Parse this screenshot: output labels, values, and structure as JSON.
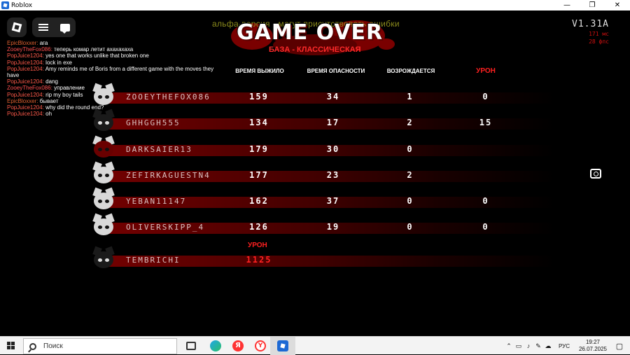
{
  "window": {
    "title": "Roblox",
    "minimize": "—",
    "restore": "❐",
    "close": "✕"
  },
  "chat": [
    {
      "name": "EpicBloxxer:",
      "name_color": "#e06030",
      "text": "ага"
    },
    {
      "name": "ZooeyTheFox086:",
      "name_color": "#ff5050",
      "text": "теперь комар летит ахахахаха"
    },
    {
      "name": "PopJuice1204:",
      "name_color": "#ff5a4a",
      "text": "yes one that works unlike that broken one"
    },
    {
      "name": "PopJuice1204:",
      "name_color": "#ff5a4a",
      "text": "lock in exe"
    },
    {
      "name": "PopJuice1204:",
      "name_color": "#ff5a4a",
      "text": "Amy reminds me of Boris from a different game with the moves they have"
    },
    {
      "name": "PopJuice1204:",
      "name_color": "#ff5a4a",
      "text": "dang"
    },
    {
      "name": "ZooeyTheFox086:",
      "name_color": "#ff5050",
      "text": "управление"
    },
    {
      "name": "PopJuice1204:",
      "name_color": "#ff5a4a",
      "text": "rip my boy tails"
    },
    {
      "name": "EpicBloxxer:",
      "name_color": "#e06030",
      "text": "бывает"
    },
    {
      "name": "PopJuice1204:",
      "name_color": "#ff5a4a",
      "text": "why did the round end?"
    },
    {
      "name": "PopJuice1204:",
      "name_color": "#ff5a4a",
      "text": "oh"
    }
  ],
  "header": {
    "alpha_note": "альфа-версия - могут присутствовать ошибки",
    "title": "GAME OVER",
    "mode": "БАЗА - КЛАССИЧЕСКАЯ",
    "version": "V1.31A",
    "ping": "171 мс",
    "fps": "28 фпс"
  },
  "columns": {
    "time": "ВРЕМЯ ВЫЖИЛО",
    "danger": "ВРЕМЯ ОПАСНОСТИ",
    "respawn": "ВОЗРОЖДАЕТСЯ",
    "damage": "УРОН"
  },
  "players": [
    {
      "name": "ZOOEYTHEFOX086",
      "time": "159",
      "danger": "34",
      "respawn": "1",
      "damage": "0",
      "avatar": "light"
    },
    {
      "name": "GHHGGH555",
      "time": "134",
      "danger": "17",
      "respawn": "2",
      "damage": "15",
      "avatar": "dark"
    },
    {
      "name": "DARKSAIER13",
      "time": "179",
      "danger": "30",
      "respawn": "0",
      "damage": "",
      "avatar": "bloody"
    },
    {
      "name": "ZEFIRKAGUESTN4",
      "time": "177",
      "danger": "23",
      "respawn": "2",
      "damage": "",
      "avatar": "light"
    },
    {
      "name": "YEBAN11147",
      "time": "162",
      "danger": "37",
      "respawn": "0",
      "damage": "0",
      "avatar": "light"
    },
    {
      "name": "OLIVERSKIPP_4",
      "time": "126",
      "danger": "19",
      "respawn": "0",
      "damage": "0",
      "avatar": "light"
    }
  ],
  "killer": {
    "damage_label": "УРОН",
    "name": "TEMBRICHI",
    "damage": "1125"
  },
  "taskbar": {
    "search_placeholder": "Поиск",
    "yandex_label": "Я",
    "yandex_browser_label": "Y",
    "lang": "РУС",
    "time": "19:27",
    "date": "26.07.2025"
  }
}
